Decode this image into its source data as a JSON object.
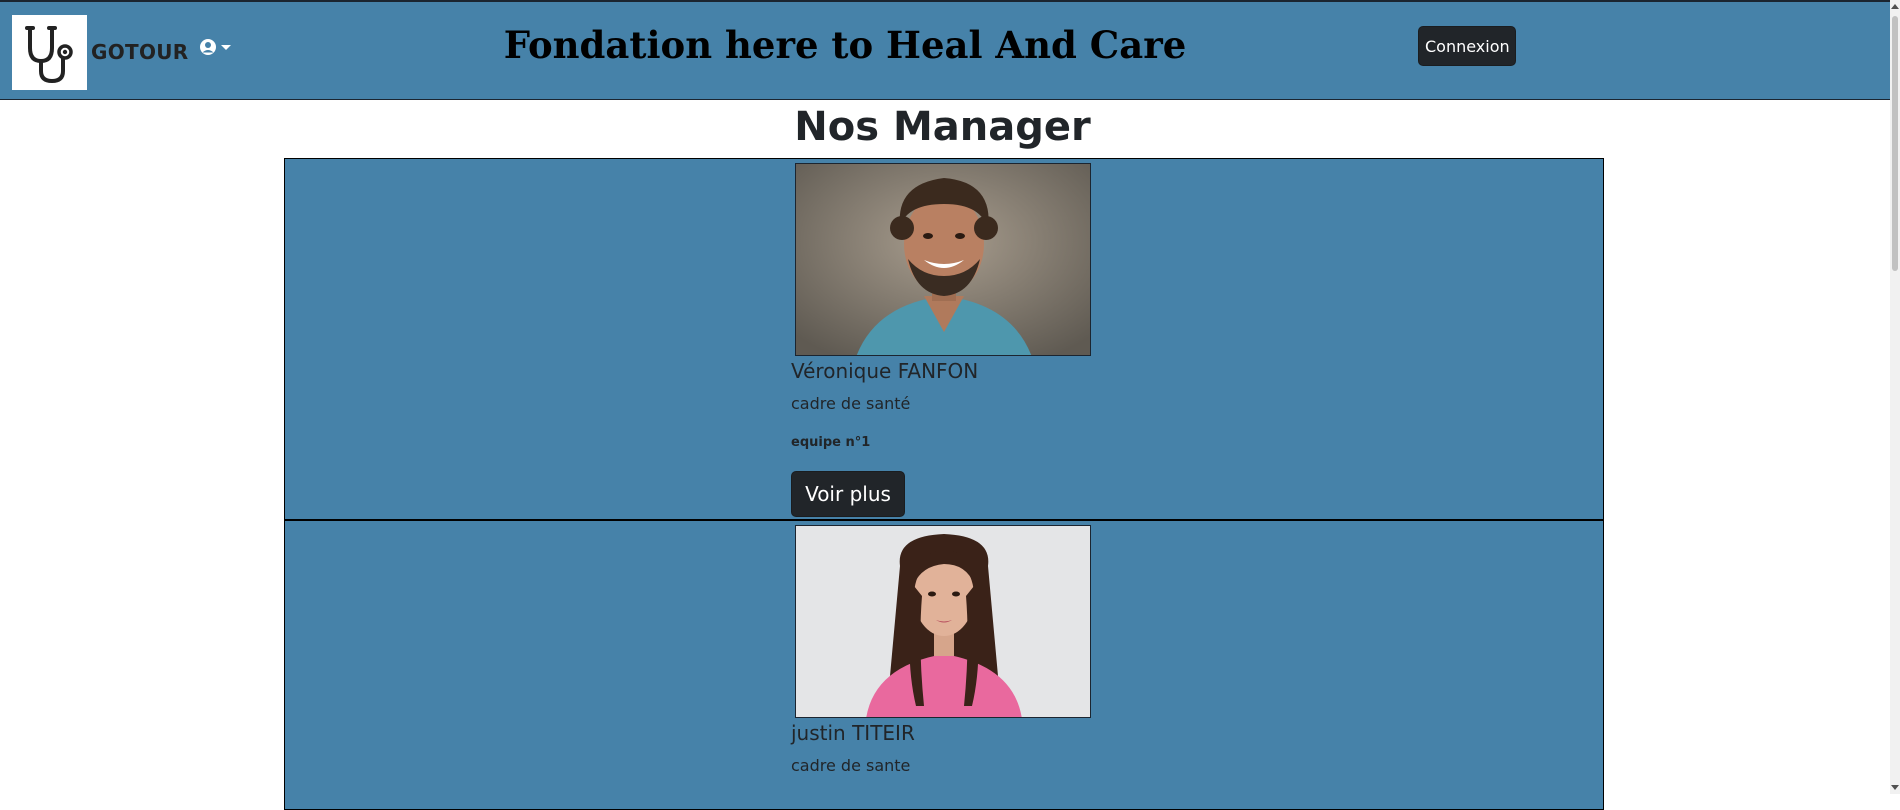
{
  "header": {
    "brand": "GOTOUR",
    "title": "Fondation here to Heal And Care",
    "login_label": "Connexion",
    "logo_icon": "stethoscope-icon",
    "dropdown_icon": "user-avatar-icon"
  },
  "page": {
    "heading": "Nos Manager"
  },
  "managers": [
    {
      "name": "Véronique FANFON",
      "role": "cadre de santé",
      "team": "equipe n°1",
      "button_label": "Voir plus",
      "photo": "smiling-man-photo"
    },
    {
      "name": "justin TITEIR",
      "role": "cadre de sante",
      "photo": "smiling-woman-photo"
    }
  ],
  "colors": {
    "header_bg": "#4682a9",
    "card_bg": "#4682a9",
    "button_bg": "#212529",
    "button_text": "#ffffff"
  }
}
